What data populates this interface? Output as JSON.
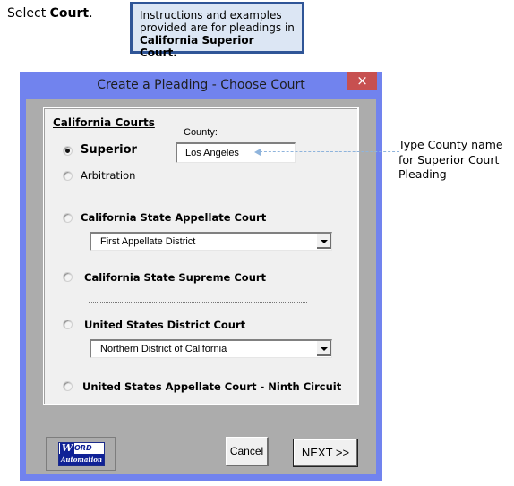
{
  "instruction": {
    "prefix": "Select ",
    "bold": "Court",
    "suffix": "."
  },
  "info_box": {
    "line1": "Instructions and examples",
    "line2": "provided are for pleadings in",
    "line3": "California Superior Court."
  },
  "dialog": {
    "title": "Create a Pleading - Choose Court",
    "close_icon": "×",
    "frame_title": "California Courts",
    "county_label": "County:",
    "county_value": "Los Angeles",
    "options": [
      {
        "label": "Superior",
        "selected": true
      },
      {
        "label": "Arbitration",
        "selected": false
      },
      {
        "label": "California State Appellate Court",
        "selected": false
      },
      {
        "label": "California State Supreme Court",
        "selected": false
      },
      {
        "label": "United States District Court",
        "selected": false
      },
      {
        "label": "United States Appellate Court - Ninth Circuit",
        "selected": false
      }
    ],
    "appellate_district": "First Appellate District",
    "district_court": "Northern District of California",
    "logo": {
      "w": "W",
      "ord": "ORD",
      "automation": "Automation"
    },
    "cancel_label": "Cancel",
    "next_label": "NEXT >>"
  },
  "annotation": {
    "line1": "Type County name",
    "line2": "for Superior Court",
    "line3": "Pleading"
  },
  "colors": {
    "window_frame": "#7183ee",
    "close_button": "#c75050",
    "info_border": "#2f5597",
    "info_background": "#dce6f4",
    "logo_blue": "#0f2196"
  }
}
